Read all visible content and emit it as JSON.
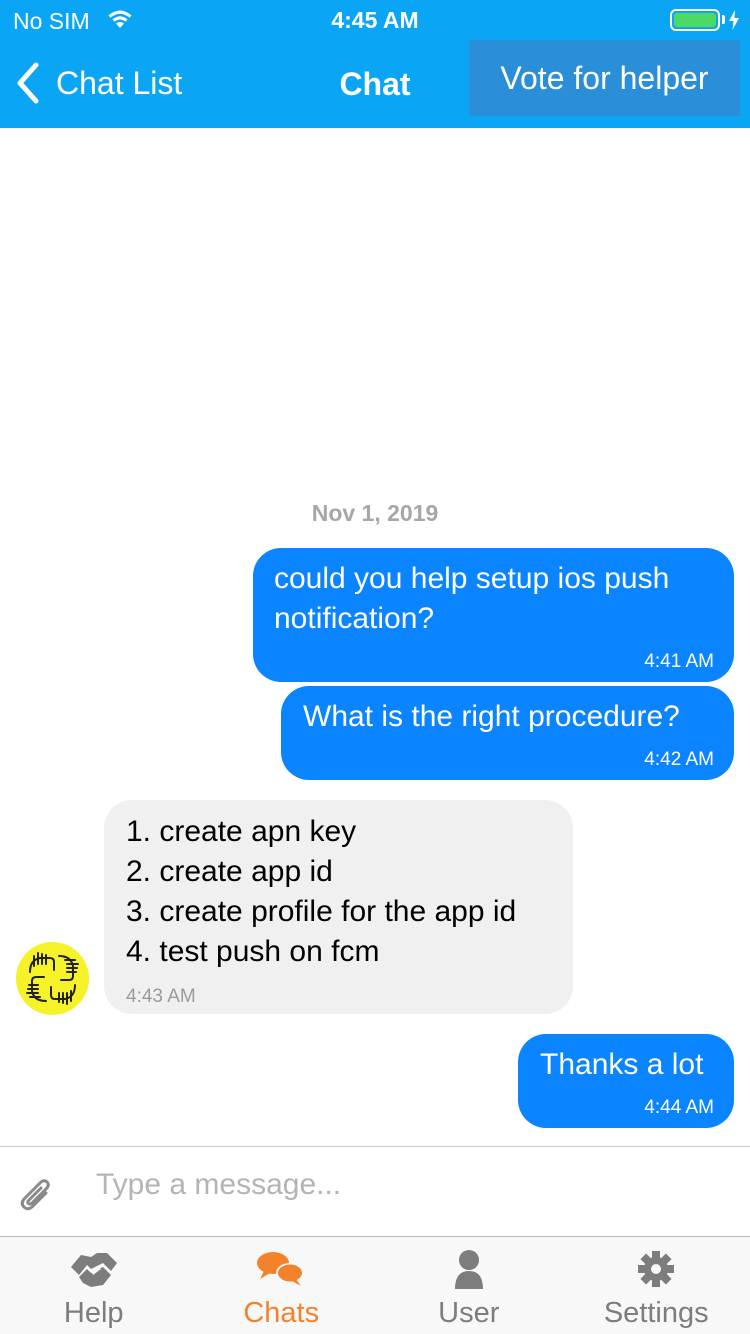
{
  "status_bar": {
    "carrier": "No SIM",
    "time": "4:45 AM",
    "battery_level": 1.0,
    "icons": [
      "wifi-icon",
      "battery-icon",
      "charging-bolt-icon"
    ]
  },
  "nav": {
    "back_label": "Chat List",
    "title": "Chat",
    "vote_label": "Vote for helper"
  },
  "chat": {
    "date": "Nov 1, 2019",
    "messages": [
      {
        "direction": "outgoing",
        "text": "could you help setup ios push notification?",
        "time": "4:41 AM"
      },
      {
        "direction": "outgoing",
        "text": "What is the right procedure?",
        "time": "4:42 AM"
      },
      {
        "direction": "incoming",
        "text": "1. create apn key\n2. create app id\n3. create profile for the app id\n4. test push on fcm",
        "time": "4:43 AM"
      },
      {
        "direction": "outgoing",
        "text": "Thanks a lot",
        "time": "4:44 AM"
      }
    ]
  },
  "composer": {
    "placeholder": "Type a message...",
    "value": ""
  },
  "tabs": [
    {
      "label": "Help",
      "icon": "handshake-icon",
      "active": false
    },
    {
      "label": "Chats",
      "icon": "chat-bubbles-icon",
      "active": true
    },
    {
      "label": "User",
      "icon": "user-icon",
      "active": false
    },
    {
      "label": "Settings",
      "icon": "gear-icon",
      "active": false
    }
  ],
  "colors": {
    "header_bg": "#0aa6f5",
    "vote_button_bg": "#2a8ed8",
    "outgoing_bubble": "#0a84ff",
    "incoming_bubble": "#f0f0f0",
    "active_tab": "#f4822b",
    "inactive_tab": "#7d7d7d",
    "avatar_bg": "#f5f22a"
  }
}
